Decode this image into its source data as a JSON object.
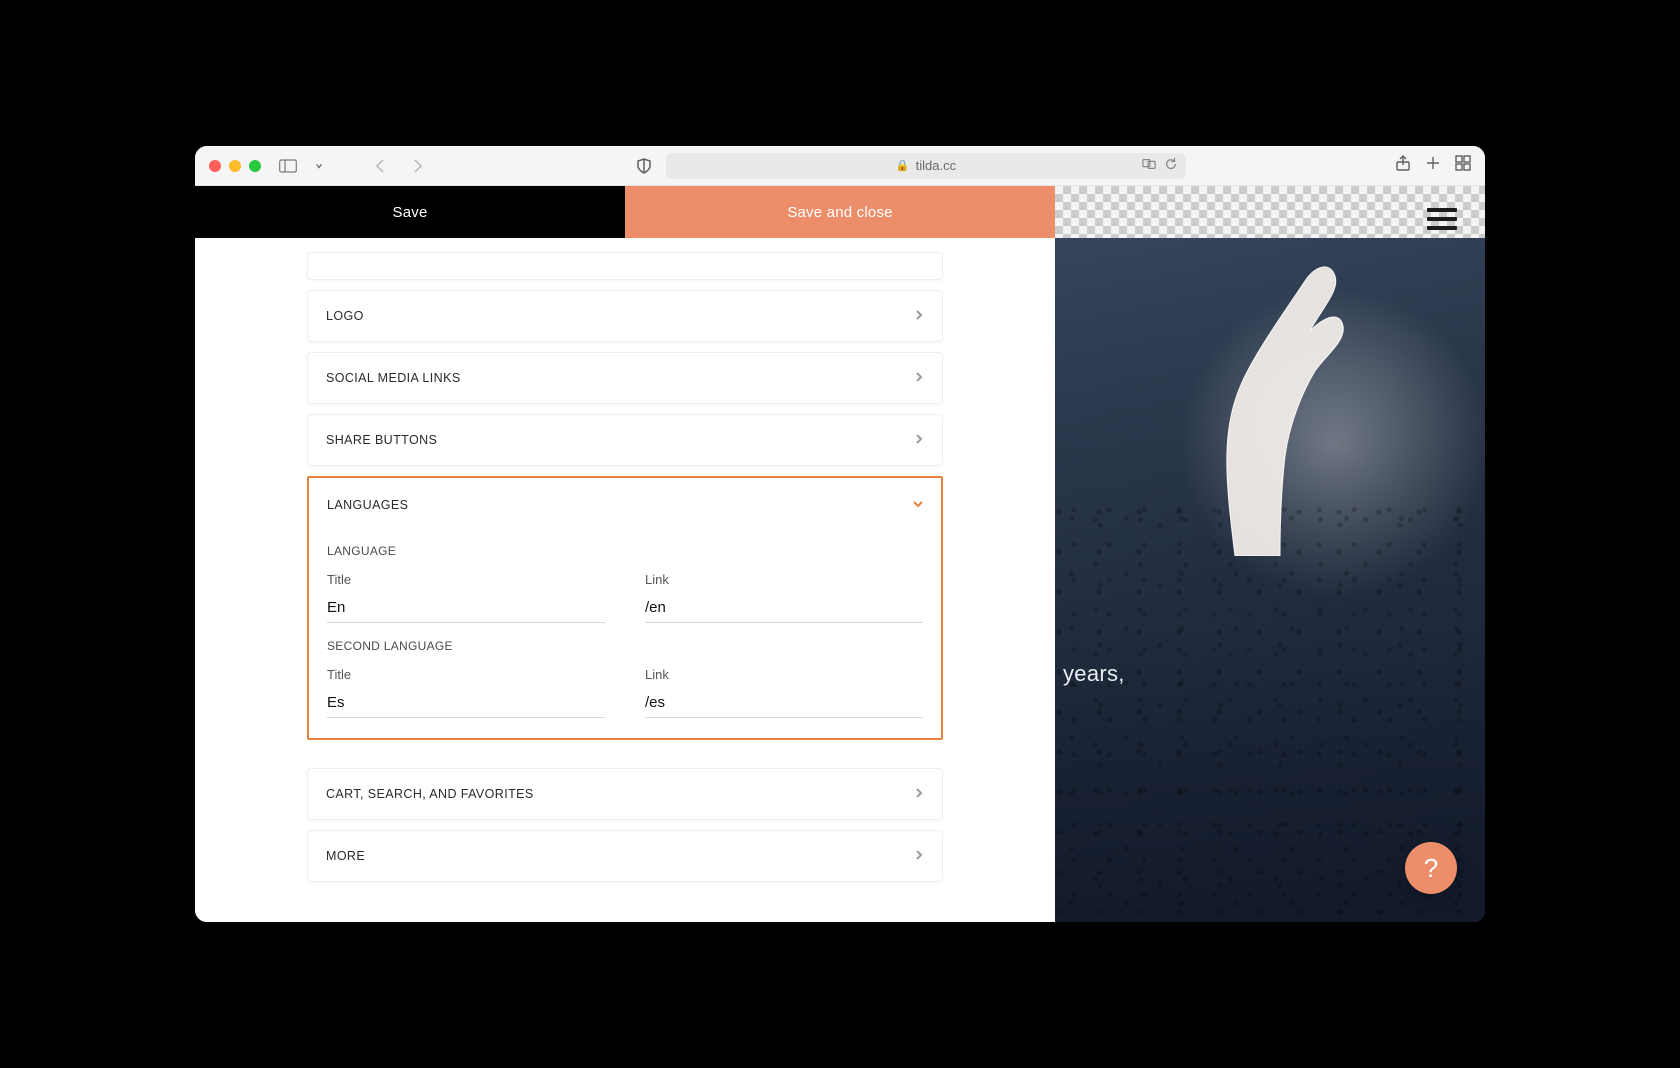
{
  "browser": {
    "url_host": "tilda.cc"
  },
  "header": {
    "save": "Save",
    "save_close": "Save and close"
  },
  "accordion": {
    "logo": "LOGO",
    "social": "SOCIAL MEDIA LINKS",
    "share": "SHARE BUTTONS",
    "languages": "LANGUAGES",
    "cart": "CART, SEARCH, AND FAVORITES",
    "more": "MORE"
  },
  "languages": {
    "block1_title": "LANGUAGE",
    "block2_title": "SECOND LANGUAGE",
    "title_label": "Title",
    "link_label": "Link",
    "lang1": {
      "title": "En",
      "link": "/en"
    },
    "lang2": {
      "title": "Es",
      "link": "/es"
    }
  },
  "preview": {
    "caption_fragment": "years,"
  },
  "help": {
    "label": "?"
  }
}
